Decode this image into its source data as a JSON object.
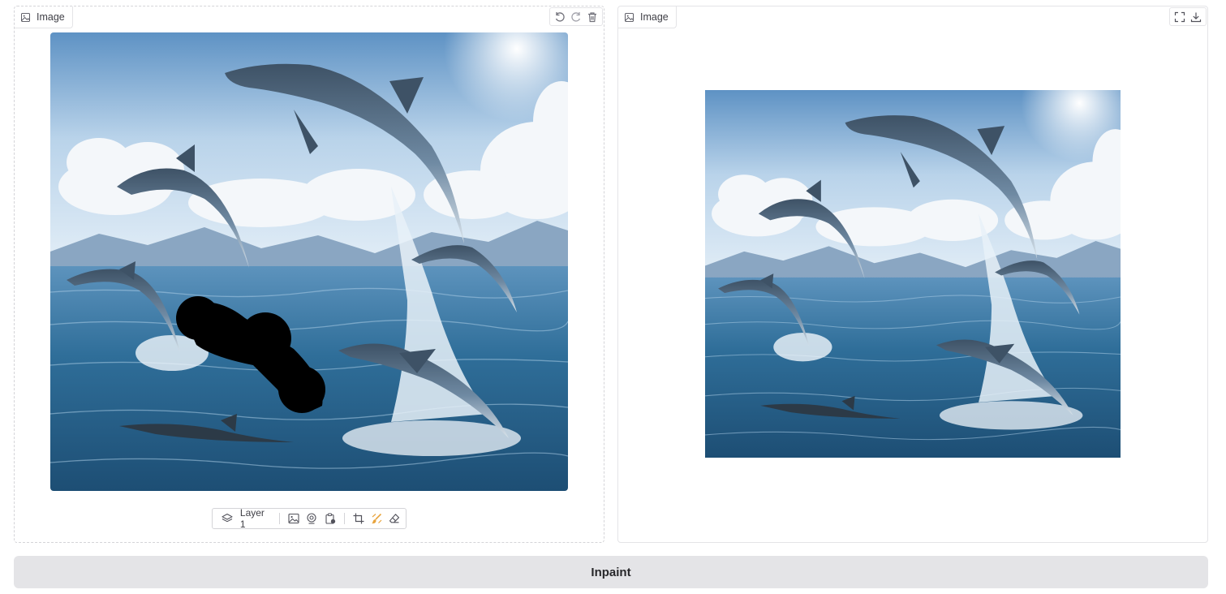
{
  "editor": {
    "label": "Image",
    "tools": {
      "undo_icon": "undo-icon",
      "redo_icon": "redo-icon",
      "clear_icon": "trash-icon"
    },
    "toolbar": {
      "layer_label": "Layer 1",
      "icons": [
        "layers-icon",
        "image-upload-icon",
        "webcam-icon",
        "clipboard-icon",
        "crop-icon",
        "brush-icon",
        "eraser-icon"
      ]
    }
  },
  "output": {
    "label": "Image",
    "tools": {
      "fullscreen_icon": "fullscreen-icon",
      "download_icon": "download-icon"
    }
  },
  "actions": {
    "inpaint_label": "Inpaint"
  },
  "colors": {
    "sky_top": "#6f9fcc",
    "sky_bottom": "#d9e8f4",
    "sea": "#2f6e99",
    "dolphin": "#4d6276",
    "mask": "#000000",
    "button_bg": "#e4e4e7",
    "border": "#e4e4e7"
  }
}
